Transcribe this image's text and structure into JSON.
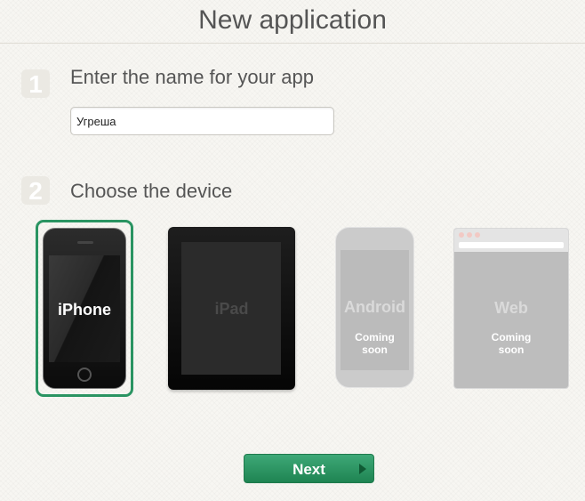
{
  "page": {
    "title": "New application"
  },
  "steps": [
    {
      "number": "1",
      "label": "Enter the name for your app"
    },
    {
      "number": "2",
      "label": "Choose the device"
    }
  ],
  "app_name": {
    "value": "Угреша",
    "placeholder": ""
  },
  "devices": [
    {
      "label": "iPhone",
      "status": "",
      "selected": true,
      "icon": "iphone-icon"
    },
    {
      "label": "iPad",
      "status": "",
      "selected": false,
      "icon": "ipad-icon"
    },
    {
      "label": "Android",
      "status_line1": "Coming",
      "status_line2": "soon",
      "selected": false,
      "icon": "android-phone-icon"
    },
    {
      "label": "Web",
      "status_line1": "Coming",
      "status_line2": "soon",
      "selected": false,
      "icon": "browser-window-icon"
    }
  ],
  "next_button": {
    "label": "Next",
    "icon": "arrow-right-icon"
  },
  "colors": {
    "accent": "#2a9462",
    "button_top": "#3ea877",
    "button_bottom": "#1f8452"
  }
}
